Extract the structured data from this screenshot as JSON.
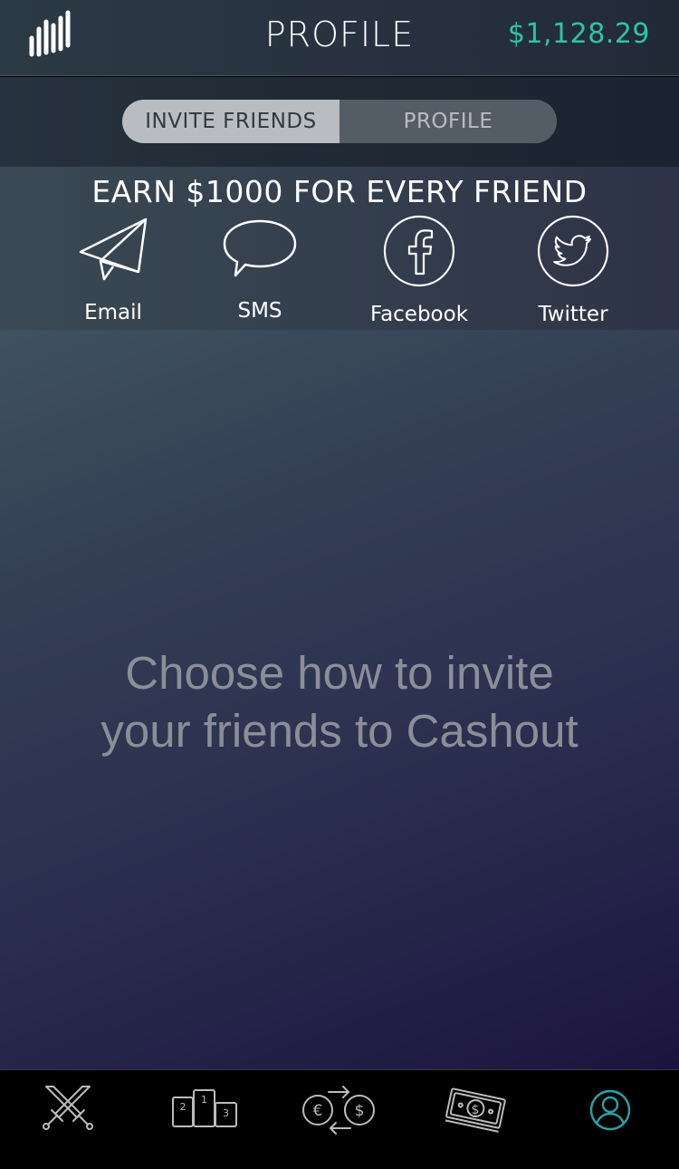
{
  "header": {
    "title": "PROFILE",
    "balance": "$1,128.29",
    "logo_icon": "bars-logo-icon",
    "balance_color": "#2ec4a6"
  },
  "segment": {
    "active_label": "INVITE FRIENDS",
    "inactive_label": "PROFILE"
  },
  "invite": {
    "headline": "EARN $1000 FOR EVERY FRIEND",
    "options": [
      {
        "label": "Email",
        "icon": "paper-plane-icon"
      },
      {
        "label": "SMS",
        "icon": "speech-bubble-icon"
      },
      {
        "label": "Facebook",
        "icon": "facebook-icon"
      },
      {
        "label": "Twitter",
        "icon": "twitter-icon"
      }
    ]
  },
  "main": {
    "prompt_line1": "Choose how to invite",
    "prompt_line2": "your friends to Cashout"
  },
  "tabbar": {
    "tabs": [
      {
        "icon": "crossed-swords-icon",
        "active": false
      },
      {
        "icon": "podium-icon",
        "active": false,
        "podium_labels": [
          "2",
          "1",
          "3"
        ]
      },
      {
        "icon": "currency-exchange-icon",
        "active": false,
        "symbols": [
          "€",
          "$"
        ]
      },
      {
        "icon": "banknote-icon",
        "active": false,
        "symbol": "$"
      },
      {
        "icon": "user-profile-icon",
        "active": true
      }
    ],
    "active_color": "#2aa3a8"
  }
}
